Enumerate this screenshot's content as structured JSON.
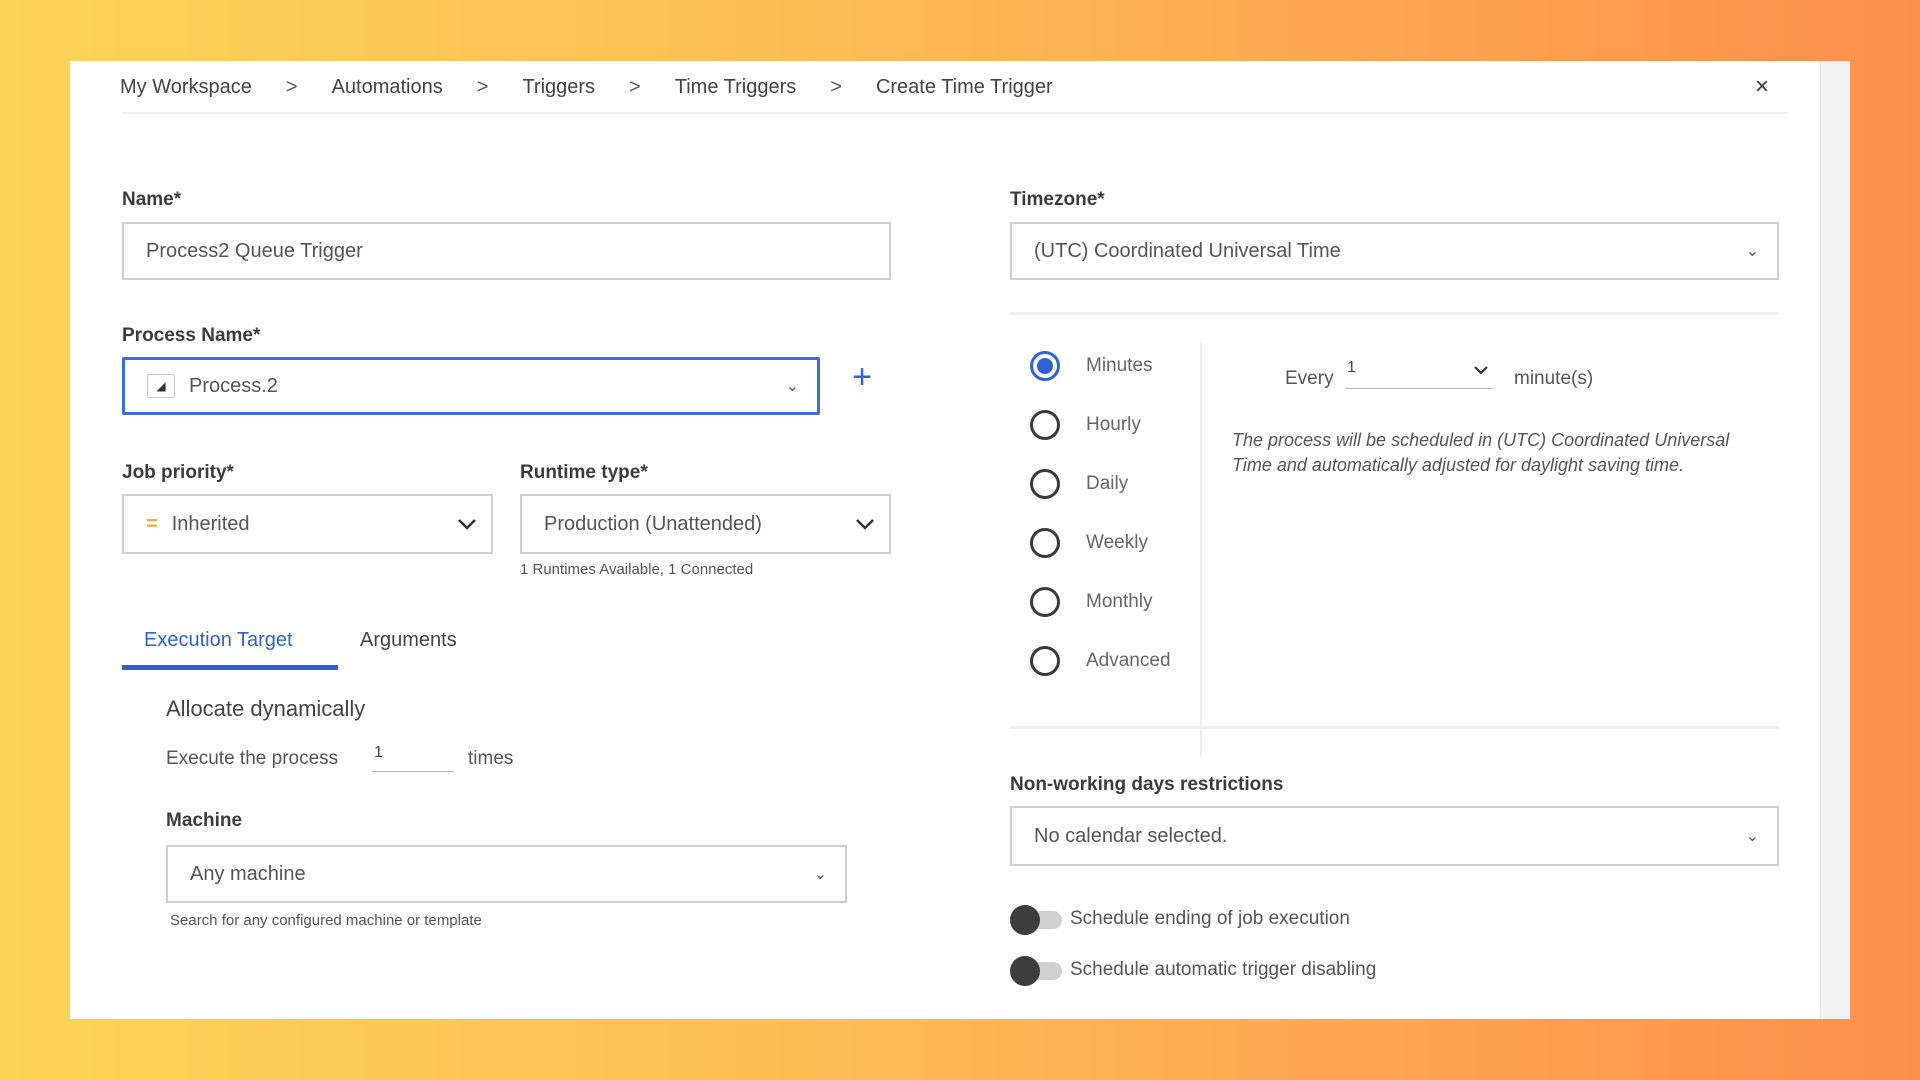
{
  "breadcrumb": [
    "My Workspace",
    "Automations",
    "Triggers",
    "Time Triggers",
    "Create Time Trigger"
  ],
  "breadcrumb_separator": ">",
  "close_icon": "×",
  "form": {
    "name_label": "Name*",
    "name_value": "Process2 Queue Trigger",
    "process_label": "Process Name*",
    "process_value": "Process.2",
    "add_icon": "+",
    "job_priority_label": "Job priority*",
    "job_priority_icon": "=",
    "job_priority_value": "Inherited",
    "runtime_label": "Runtime type*",
    "runtime_value": "Production (Unattended)",
    "runtime_helper": "1 Runtimes Available, 1 Connected",
    "tabs": [
      "Execution Target",
      "Arguments"
    ],
    "allocate_title": "Allocate dynamically",
    "execute_prefix": "Execute the process",
    "execute_value": "1",
    "execute_suffix": "times",
    "machine_label": "Machine",
    "machine_value": "Any machine",
    "machine_helper": "Search for any configured machine or template"
  },
  "schedule": {
    "timezone_label": "Timezone*",
    "timezone_value": "(UTC) Coordinated Universal Time",
    "frequencies": [
      "Minutes",
      "Hourly",
      "Daily",
      "Weekly",
      "Monthly",
      "Advanced"
    ],
    "selected_frequency": "Minutes",
    "every_label": "Every",
    "every_value": "1",
    "every_unit": "minute(s)",
    "note": "The process will be scheduled in (UTC) Coordinated Universal Time and automatically adjusted for daylight saving time.",
    "nonworking_label": "Non-working days restrictions",
    "nonworking_value": "No calendar selected.",
    "toggle_ending": "Schedule ending of job execution",
    "toggle_disabling": "Schedule automatic trigger disabling"
  },
  "colors": {
    "accent": "#2f64d0",
    "priority_icon": "#f2a93b",
    "background_left": "#fcd457",
    "background_right": "#fd8f4c"
  }
}
